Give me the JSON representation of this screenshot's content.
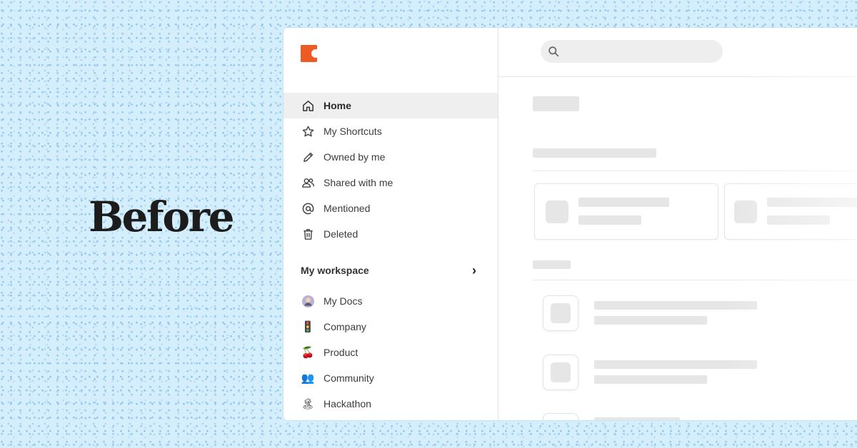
{
  "overlay": {
    "label": "Before"
  },
  "sidebar": {
    "nav": [
      {
        "label": "Home",
        "icon": "home-icon",
        "active": true
      },
      {
        "label": "My Shortcuts",
        "icon": "star-icon"
      },
      {
        "label": "Owned by me",
        "icon": "pencil-icon"
      },
      {
        "label": "Shared with me",
        "icon": "people-icon"
      },
      {
        "label": "Mentioned",
        "icon": "at-icon"
      },
      {
        "label": "Deleted",
        "icon": "trash-icon"
      }
    ],
    "workspace": {
      "title": "My workspace",
      "chevron": "›",
      "items": [
        {
          "label": "My Docs",
          "emoji": "🧑"
        },
        {
          "label": "Company",
          "emoji": "🚦"
        },
        {
          "label": "Product",
          "emoji": "🍒"
        },
        {
          "label": "Community",
          "emoji": "👥"
        },
        {
          "label": "Hackathon",
          "emoji": "🏝"
        }
      ]
    }
  },
  "search": {
    "placeholder": "",
    "value": ""
  },
  "colors": {
    "brand": "#ee5a24",
    "active_bg": "#efefef",
    "skeleton": "#e6e6e6",
    "background": "#d4eefb"
  }
}
